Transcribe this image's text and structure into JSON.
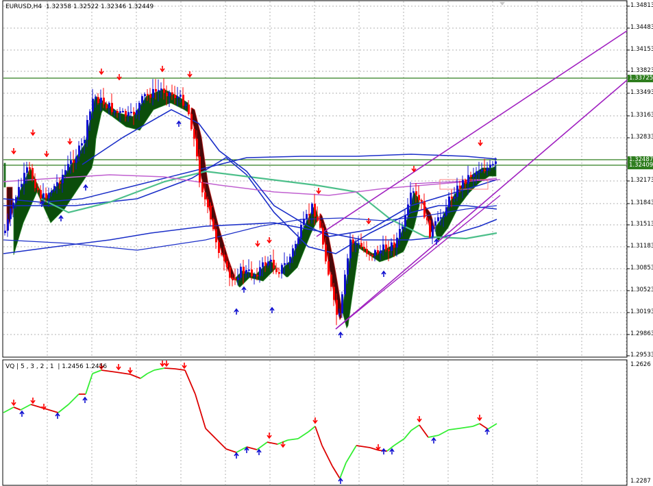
{
  "chart": {
    "symbol_header": "EURUSD,H4  1.32358 1.32522 1.32346 1.32449",
    "main_axis_labels": [
      "1.34813",
      "1.34483",
      "1.34153",
      "1.33823",
      "1.33493",
      "1.33163",
      "1.32833",
      "1.32173",
      "1.31843",
      "1.31513",
      "1.31183",
      "1.30853",
      "1.30523",
      "1.30193",
      "1.29863",
      "1.29533"
    ],
    "level_tags": [
      {
        "text": "1.33725",
        "color": "#2e7d1e"
      },
      {
        "text": "1.32487",
        "color": "#2e7d1e"
      },
      {
        "text": "1.32409",
        "color": "#2e7d1e"
      }
    ],
    "indicator_header": "VQ | 5 , 3 , 2 , 1  | 1.2456 1.2456",
    "indicator_axis_labels": [
      "1.2626",
      "1.2287"
    ],
    "colors": {
      "bull_candle": "#1010d0",
      "bear_candle": "#ff0000",
      "cloud_up": "#0b4d0b",
      "cloud_down": "#4a0a0a",
      "level_line": "#2e7d1e",
      "channel": "#a020c0",
      "ma_blue": "#1a2ec8",
      "ma_green": "#4cbf8a",
      "ma_magenta": "#c060d0",
      "vq_up": "#33ee33",
      "vq_down": "#dd0000",
      "grid": "#b0b0b0"
    }
  }
}
